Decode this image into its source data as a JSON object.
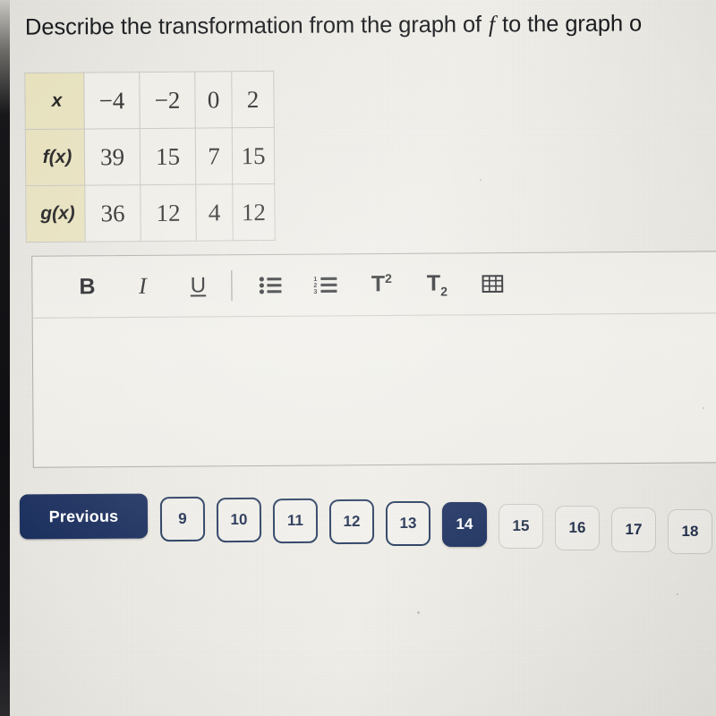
{
  "prompt": {
    "text_before_var": "Describe the transformation from the graph of ",
    "variable": "f",
    "text_after_var": " to the graph o"
  },
  "table": {
    "row_labels": [
      "x",
      "f(x)",
      "g(x)"
    ],
    "rows": [
      {
        "label": "x",
        "values": [
          "−4",
          "−2",
          "0",
          "2"
        ]
      },
      {
        "label": "f(x)",
        "values": [
          "39",
          "15",
          "7",
          "15"
        ]
      },
      {
        "label": "g(x)",
        "values": [
          "36",
          "12",
          "4",
          "12"
        ]
      }
    ]
  },
  "editor": {
    "toolbar": [
      {
        "name": "bold",
        "label": "B",
        "icon": "bold-icon"
      },
      {
        "name": "italic",
        "label": "I",
        "icon": "italic-icon"
      },
      {
        "name": "underline",
        "label": "U",
        "icon": "underline-icon"
      },
      {
        "name": "separator",
        "label": "",
        "icon": "divider"
      },
      {
        "name": "bulleted-list",
        "label": "",
        "icon": "bulleted-list-icon"
      },
      {
        "name": "numbered-list",
        "label": "",
        "icon": "numbered-list-icon"
      },
      {
        "name": "superscript",
        "label": "T",
        "icon": "superscript-icon",
        "script": "2"
      },
      {
        "name": "subscript",
        "label": "T",
        "icon": "subscript-icon",
        "script": "2"
      },
      {
        "name": "insert-table",
        "label": "",
        "icon": "table-grid-icon"
      }
    ],
    "content": "",
    "placeholder": ""
  },
  "pagination": {
    "previous_label": "Previous",
    "current_page": "14",
    "pages": [
      {
        "label": "9",
        "state": "strong"
      },
      {
        "label": "10",
        "state": "strong"
      },
      {
        "label": "11",
        "state": "strong"
      },
      {
        "label": "12",
        "state": "strong"
      },
      {
        "label": "13",
        "state": "strong"
      },
      {
        "label": "14",
        "state": "active"
      },
      {
        "label": "15",
        "state": "faint"
      },
      {
        "label": "16",
        "state": "faint"
      },
      {
        "label": "17",
        "state": "faint"
      },
      {
        "label": "18",
        "state": "faint"
      }
    ]
  },
  "colors": {
    "accent_navy": "#1b2f5e",
    "table_label_bg": "#e6e0bc",
    "page_bg": "#eeece6"
  }
}
